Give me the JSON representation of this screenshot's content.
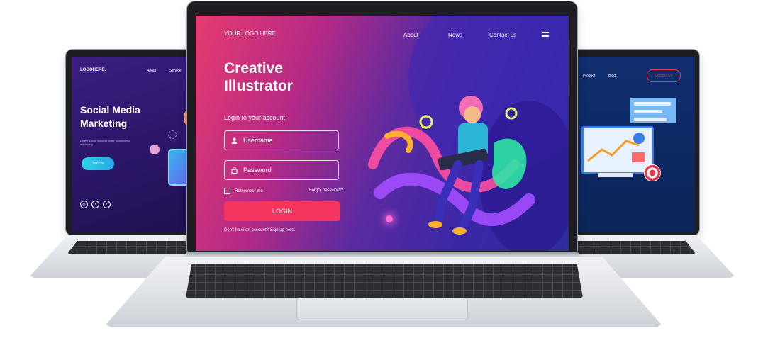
{
  "left_screen": {
    "logo": "LOGOHERE.",
    "nav": [
      "About",
      "Service"
    ],
    "title": "Social Media\nMarketing",
    "subtitle": "Lorem ipsum dolor sit amet, consectetur adipiscing",
    "cta": "Join Us",
    "social_icons": [
      "instagram-icon",
      "twitter-icon",
      "facebook-icon"
    ]
  },
  "center_screen": {
    "logo": "YOUR LOGO HERE",
    "nav": [
      "About",
      "News",
      "Contact us"
    ],
    "heading": "Creative\nIllustrator",
    "login_prompt": "Login  to your account",
    "username_placeholder": "Username",
    "password_placeholder": "Password",
    "remember_me": "Remember me",
    "forgot_password": "Forgot password?",
    "login_button": "LOGIN",
    "signup_text": "Don't have an account? Sign up here.",
    "colors": {
      "login_button": "#f3345e",
      "accent_pink": "#e63b6f",
      "accent_purple": "#3a27a6"
    }
  },
  "right_screen": {
    "nav": [
      "Product",
      "Blog"
    ],
    "cta": "Contact Us",
    "colors": {
      "background": "#102e6e",
      "cta_border": "#e8364f"
    }
  }
}
